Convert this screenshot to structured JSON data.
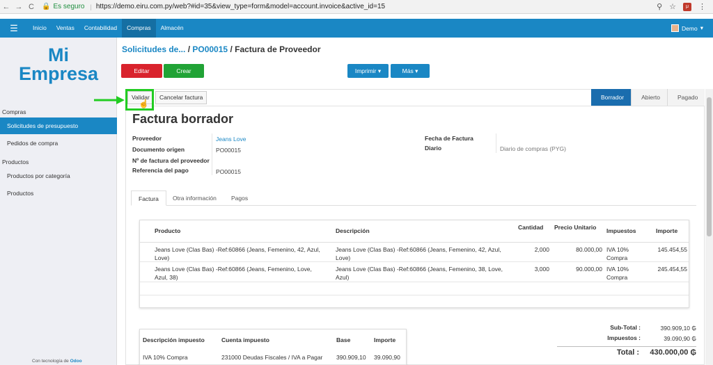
{
  "browser": {
    "back": "←",
    "forward": "→",
    "reload": "C",
    "secure_label": "Es seguro",
    "url": "https://demo.eiru.com.py/web?#id=35&view_type=form&model=account.invoice&active_id=15",
    "ext_badge": "μ"
  },
  "topmenu": {
    "items": [
      "Inicio",
      "Ventas",
      "Contabilidad",
      "Compras",
      "Almacén"
    ],
    "active": "Compras",
    "user": "Demo"
  },
  "sidebar": {
    "logo_line1": "Mi",
    "logo_line2": "Empresa",
    "sections": [
      {
        "heading": "Compras",
        "items": [
          "Solicitudes de presupuesto",
          "Pedidos de compra"
        ]
      },
      {
        "heading": "Productos",
        "items": [
          "Productos por categoría",
          "Productos"
        ]
      }
    ],
    "active_item": "Solicitudes de presupuesto",
    "powered_prefix": "Con tecnología de ",
    "powered_brand": "Odoo"
  },
  "breadcrumb": {
    "part1": "Solicitudes de...",
    "part2": "PO00015",
    "current": "Factura de Proveedor"
  },
  "buttons": {
    "edit": "Editar",
    "create": "Crear",
    "print": "Imprimir ▾",
    "more": "Más ▾",
    "validate": "Validar",
    "cancel_invoice": "Cancelar factura"
  },
  "statusbar": [
    "Borrador",
    "Abierto",
    "Pagado"
  ],
  "form": {
    "title": "Factura borrador",
    "fields": {
      "proveedor_label": "Proveedor",
      "proveedor_value": "Jeans Love",
      "doc_origen_label": "Documento origen",
      "doc_origen_value": "PO00015",
      "nro_factura_label": "Nº de factura del proveedor",
      "referencia_label": "Referencia del pago",
      "referencia_value": "PO00015",
      "fecha_label": "Fecha de Factura",
      "diario_label": "Diario",
      "diario_value": "Diario de compras (PYG)"
    }
  },
  "tabs": [
    "Factura",
    "Otra información",
    "Pagos"
  ],
  "invoice_lines": {
    "headers": [
      "Producto",
      "Descripción",
      "Cantidad",
      "Precio Unitario",
      "Impuestos",
      "Importe"
    ],
    "rows": [
      {
        "product_1": "Jeans Love (Clas Bas) -Ref:60866 (Jeans, Femenino, 42, Azul,",
        "product_2": "Love)",
        "desc_1": "Jeans Love (Clas Bas) -Ref:60866 (Jeans, Femenino, 42, Azul,",
        "desc_2": "Love)",
        "qty": "2,000",
        "price": "80.000,00",
        "tax_1": "IVA 10%",
        "tax_2": "Compra",
        "amount": "145.454,55"
      },
      {
        "product_1": "Jeans Love (Clas Bas) -Ref:60866 (Jeans, Femenino, Love,",
        "product_2": "Azul, 38)",
        "desc_1": "Jeans Love (Clas Bas) -Ref:60866 (Jeans, Femenino, 38, Love,",
        "desc_2": "Azul)",
        "qty": "3,000",
        "price": "90.000,00",
        "tax_1": "IVA 10%",
        "tax_2": "Compra",
        "amount": "245.454,55"
      }
    ]
  },
  "tax_table": {
    "headers": [
      "Descripción impuesto",
      "Cuenta impuesto",
      "Base",
      "Importe"
    ],
    "row": [
      "IVA 10% Compra",
      "231000 Deudas Fiscales / IVA a Pagar",
      "390.909,10",
      "39.090,90"
    ]
  },
  "totals": {
    "subtotal_label": "Sub-Total :",
    "subtotal_value": "390.909,10 ₲",
    "taxes_label": "Impuestos :",
    "taxes_value": "39.090,90 ₲",
    "total_label": "Total :",
    "total_value": "430.000,00 ₲"
  },
  "colors": {
    "brand": "#1a87c4",
    "edit": "#d9232d",
    "create": "#21a336",
    "highlight": "#22cc22"
  }
}
